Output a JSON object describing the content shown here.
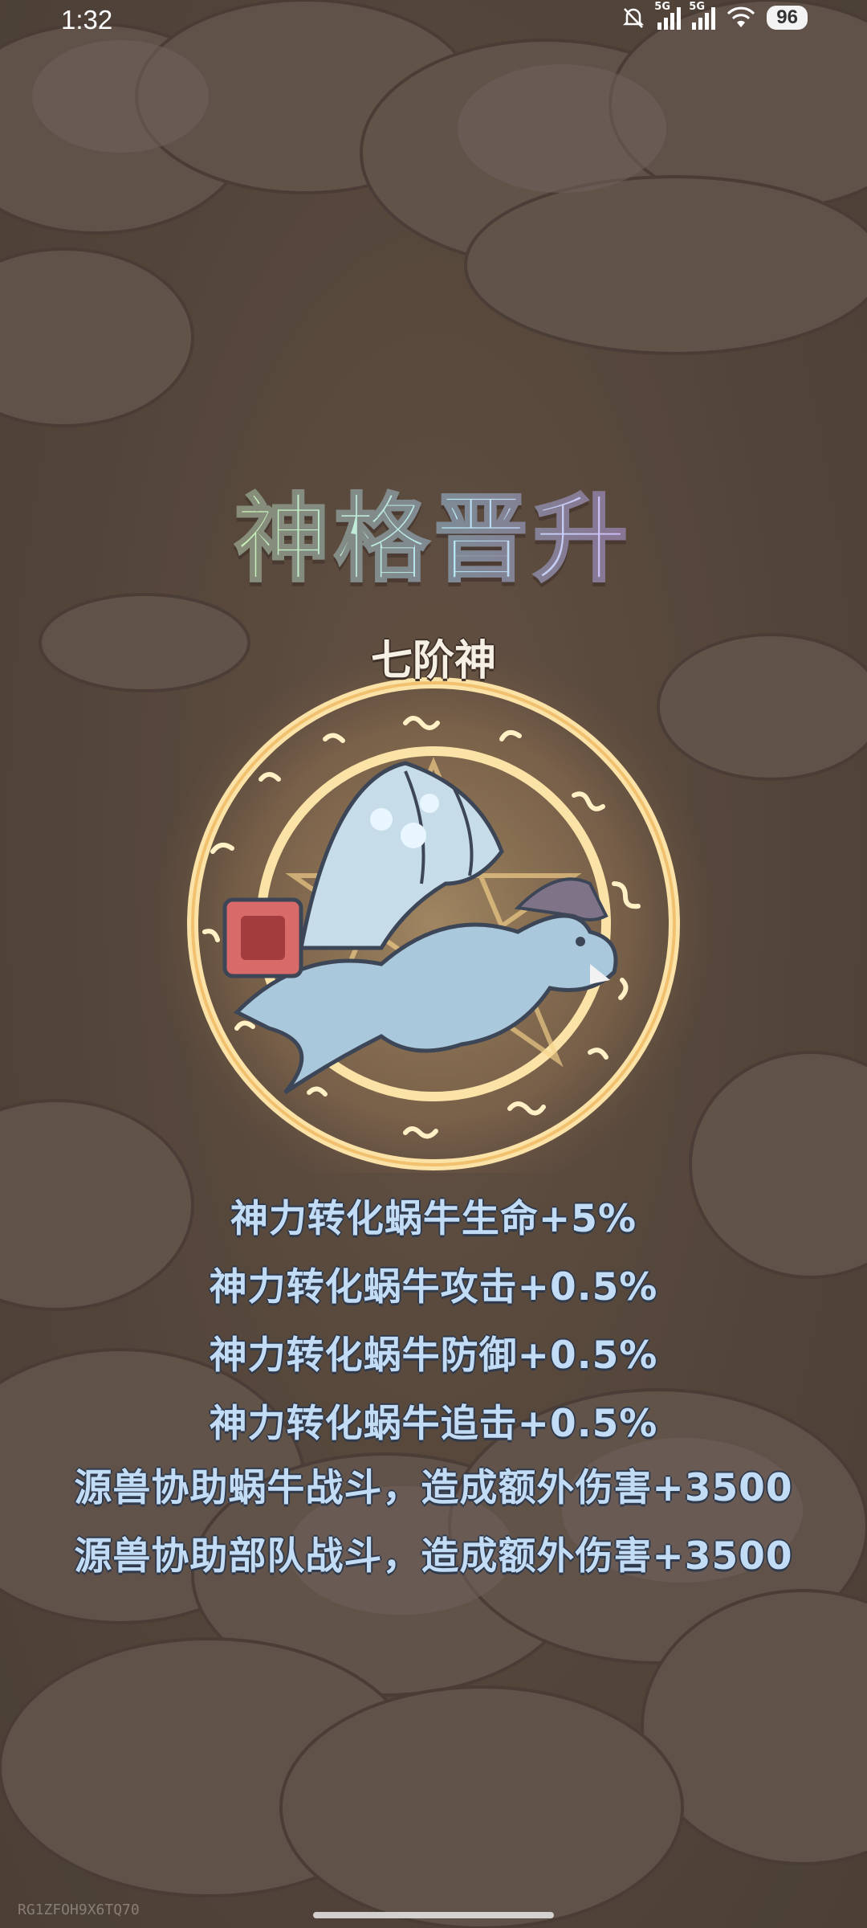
{
  "status": {
    "time": "1:32",
    "network1": "5G",
    "network2": "5G",
    "battery": "96"
  },
  "title": "神格晋升",
  "rank": "七阶神",
  "bonuses": [
    "神力转化蜗牛生命+5%",
    "神力转化蜗牛攻击+0.5%",
    "神力转化蜗牛防御+0.5%",
    "神力转化蜗牛追击+0.5%",
    "源兽协助蜗牛战斗，造成额外伤害+3500",
    "源兽协助部队战斗，造成额外伤害+3500"
  ],
  "watermark": "RG1ZFOH9X6TQ70",
  "colors": {
    "title_gradient": [
      "#f5b8d8",
      "#c9f0b7",
      "#b7e8f5",
      "#d2b6f6"
    ],
    "bonus_text": "#c3dcf6",
    "ring": "#f6d28a"
  },
  "icons": [
    "mute-bell-icon",
    "signal-icon",
    "wifi-icon",
    "battery-icon",
    "dragon-creature",
    "magic-circle"
  ]
}
